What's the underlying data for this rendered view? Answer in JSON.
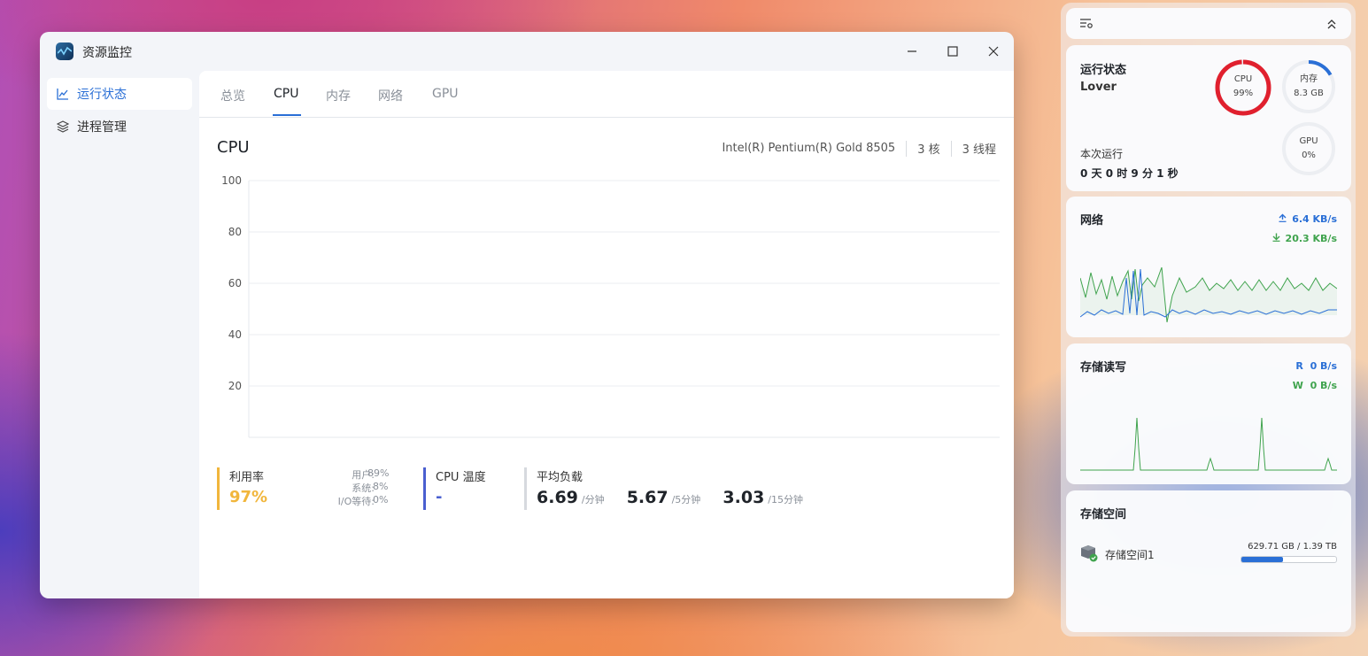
{
  "window": {
    "title": "资源监控",
    "controls": [
      "minimize-icon",
      "maximize-icon",
      "close-icon"
    ]
  },
  "sidebar": {
    "items": [
      {
        "label": "运行状态",
        "icon": "line-chart-icon",
        "active": true
      },
      {
        "label": "进程管理",
        "icon": "layers-icon",
        "active": false
      }
    ]
  },
  "tabs": [
    {
      "label": "总览",
      "active": false
    },
    {
      "label": "CPU",
      "active": true
    },
    {
      "label": "内存",
      "active": false
    },
    {
      "label": "网络",
      "active": false
    },
    {
      "label": "GPU",
      "active": false
    }
  ],
  "cpu": {
    "title": "CPU",
    "model": "Intel(R) Pentium(R) Gold 8505",
    "cores": "3 核",
    "threads": "3 线程"
  },
  "chart_data": {
    "type": "line",
    "title": "",
    "xlabel": "",
    "ylabel": "",
    "ylim": [
      0,
      100
    ],
    "yticks": [
      20,
      40,
      60,
      80,
      100
    ],
    "grid": true,
    "series": [
      {
        "values": []
      }
    ]
  },
  "stats": {
    "usage": {
      "label": "利用率",
      "value": "97%",
      "user_label": "用户:",
      "user_value": "89%",
      "system_label": "系统:",
      "system_value": "8%",
      "io_label": "I/O等待:",
      "io_value": "0%"
    },
    "temperature": {
      "label": "CPU 温度",
      "value": "-"
    },
    "load": {
      "label": "平均负载",
      "values": [
        {
          "value": "6.69",
          "unit": "/分钟"
        },
        {
          "value": "5.67",
          "unit": "/5分钟"
        },
        {
          "value": "3.03",
          "unit": "/15分钟"
        }
      ]
    }
  },
  "widget": {
    "toolbar": {
      "settings_icon": "settings-list-icon",
      "collapse_icon": "chevron-up-double-icon"
    },
    "status": {
      "title": "运行状态",
      "host": "Lover",
      "uptime_label": "本次运行",
      "uptime": "0 天 0 时 9 分 1 秒",
      "cpu": {
        "label": "CPU",
        "value": "99%",
        "level": 0.99,
        "color": "#e0202e"
      },
      "memory": {
        "label": "内存",
        "value": "8.3 GB",
        "level": 0.17,
        "color": "#2a6fd6"
      },
      "gpu": {
        "label": "GPU",
        "value": "0%",
        "level": 0
      }
    },
    "network": {
      "title": "网络",
      "upload": "6.4 KB/s",
      "download": "20.3 KB/s",
      "upload_color": "#2a6fd6",
      "download_color": "#3fa34d"
    },
    "disk_io": {
      "title": "存储读写",
      "read_label": "R",
      "read": "0 B/s",
      "write_label": "W",
      "write": "0 B/s"
    },
    "storage": {
      "title": "存储空间",
      "name": "存储空间1",
      "usage": "629.71 GB / 1.39 TB",
      "level": 0.44
    }
  }
}
